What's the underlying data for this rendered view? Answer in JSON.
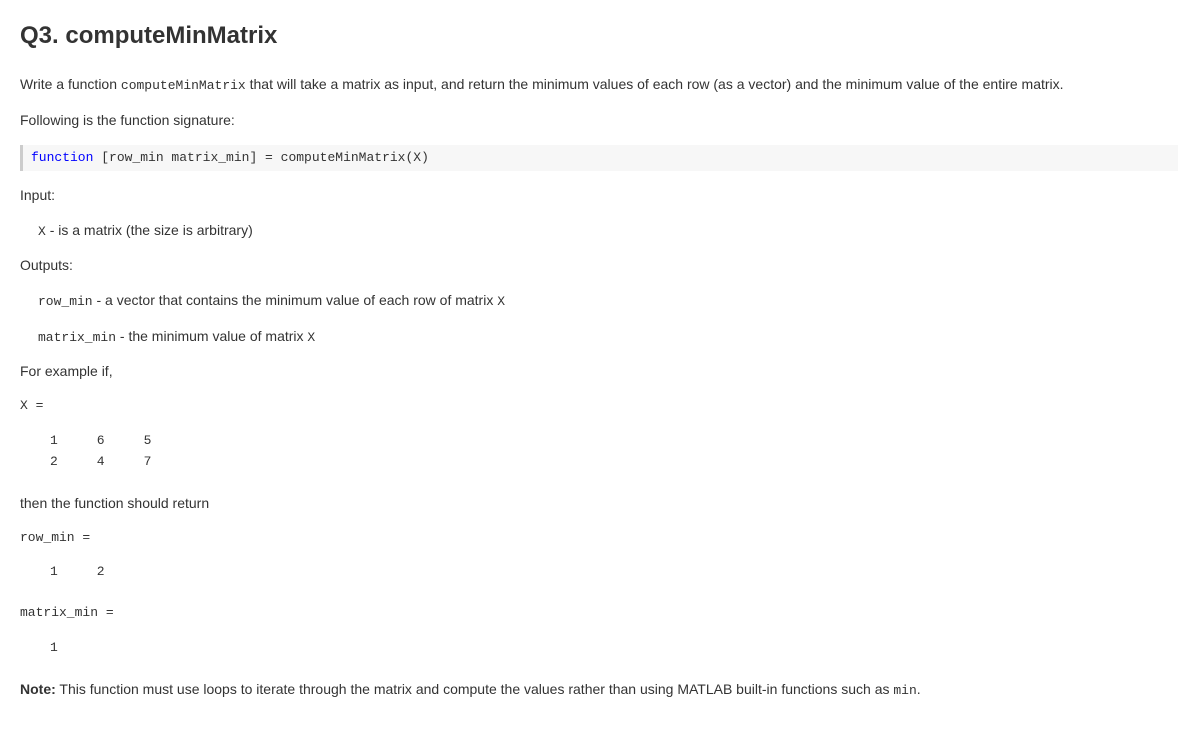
{
  "title": "Q3. computeMinMatrix",
  "intro_pre": "Write a function ",
  "intro_code": "computeMinMatrix",
  "intro_post": " that will take a matrix as input, and return the minimum values of each row (as a vector) and the minimum value of the entire matrix.",
  "sig_label": "Following is the function signature:",
  "signature_kw": "function",
  "signature_rest": " [row_min matrix_min] = computeMinMatrix(X)",
  "input_label": "Input:",
  "input_x_code": "X",
  "input_x_desc": " - is a matrix (the size is arbitrary)",
  "output_label": "Outputs:",
  "out_rowmin_code": "row_min",
  "out_rowmin_desc_pre": " - a vector that contains the minimum value of each row of matrix ",
  "out_rowmin_desc_code2": "X",
  "out_matrixmin_code": "matrix_min",
  "out_matrixmin_desc_pre": " - the minimum value of matrix ",
  "out_matrixmin_desc_code2": "X",
  "example_label": "For example if,",
  "example_x_header": "X =",
  "example_x_matrix": "1     6     5\n2     4     7",
  "then_label": "then the function should return",
  "rowmin_header": "row_min =",
  "rowmin_values": "1     2",
  "matrixmin_header": "matrix_min =",
  "matrixmin_value": "1",
  "note_bold": "Note:",
  "note_text_pre": " This function must use loops to iterate through the matrix and compute the values rather than using MATLAB built-in functions such as ",
  "note_text_code": "min",
  "note_text_post": "."
}
